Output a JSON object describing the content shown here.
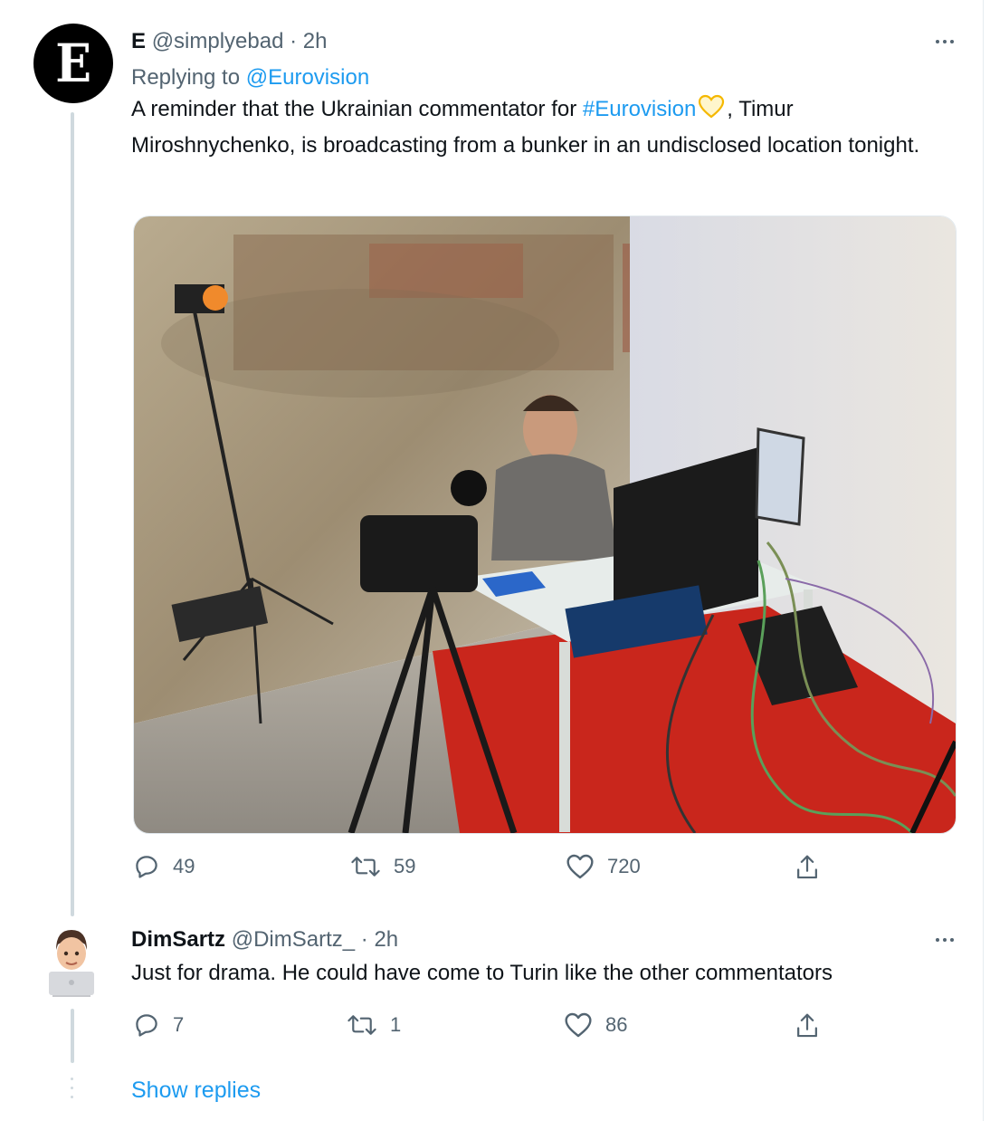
{
  "tweet1": {
    "name": "E",
    "handle": "@simplyebad",
    "sep": "·",
    "time": "2h",
    "avatar_letter": "E",
    "replying_prefix": "Replying to",
    "replying_handle": "@Eurovision",
    "text_part1": "A reminder that the Ukrainian commentator for ",
    "hashtag": "#Eurovision",
    "text_part2": ", Timur Miroshnychenko, is broadcasting from a bunker in an undisclosed location tonight.",
    "emoji_icon": "yellow-heart-icon",
    "media_icon": "photo-commentator-bunker",
    "actions": {
      "replies": "49",
      "retweets": "59",
      "likes": "720"
    }
  },
  "tweet2": {
    "name": "DimSartz",
    "handle": "@DimSartz_",
    "sep": "·",
    "time": "2h",
    "avatar_icon": "memoji-laptop-avatar",
    "text": "Just for drama. He could have come to Turin like the other commentators",
    "actions": {
      "replies": "7",
      "retweets": "1",
      "likes": "86"
    }
  },
  "show_replies": "Show replies",
  "colors": {
    "link": "#1d9bf0",
    "muted": "#536471",
    "text": "#0f1419",
    "thread": "#cfd9de"
  }
}
